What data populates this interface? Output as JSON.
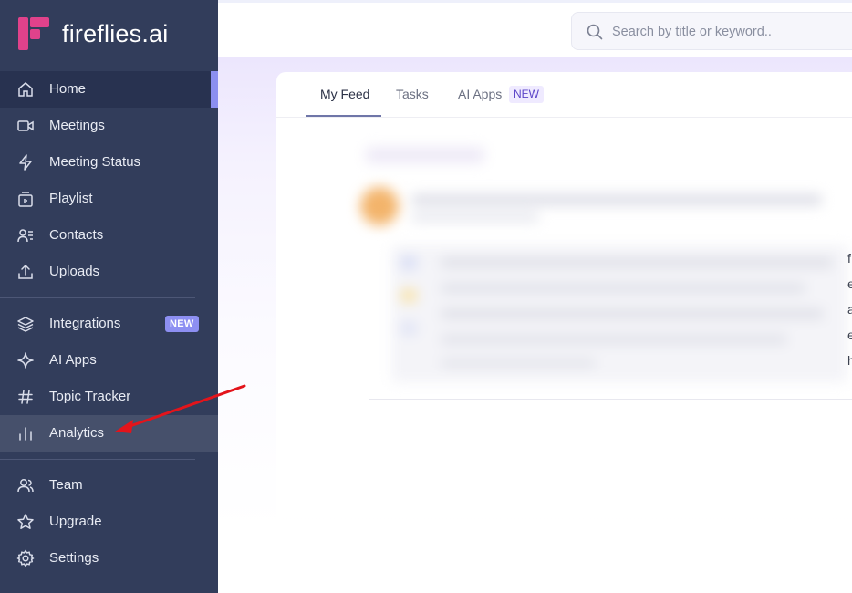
{
  "brand": {
    "name": "fireflies.ai",
    "logo_color": "#e0428b"
  },
  "search": {
    "placeholder": "Search by title or keyword.."
  },
  "sidebar": {
    "items": [
      {
        "label": "Home",
        "icon": "home-icon"
      },
      {
        "label": "Meetings",
        "icon": "video-camera-icon"
      },
      {
        "label": "Meeting Status",
        "icon": "lightning-icon"
      },
      {
        "label": "Playlist",
        "icon": "playlist-icon"
      },
      {
        "label": "Contacts",
        "icon": "contacts-icon"
      },
      {
        "label": "Uploads",
        "icon": "upload-icon"
      },
      {
        "label": "Integrations",
        "icon": "layers-icon",
        "badge": "NEW"
      },
      {
        "label": "AI Apps",
        "icon": "sparkle-icon"
      },
      {
        "label": "Topic Tracker",
        "icon": "hashtag-icon"
      },
      {
        "label": "Analytics",
        "icon": "bar-chart-icon"
      },
      {
        "label": "Team",
        "icon": "team-icon"
      },
      {
        "label": "Upgrade",
        "icon": "star-icon"
      },
      {
        "label": "Settings",
        "icon": "gear-icon"
      }
    ]
  },
  "tabs": {
    "items": [
      {
        "label": "My Feed"
      },
      {
        "label": "Tasks"
      },
      {
        "label": "AI Apps",
        "badge": "NEW"
      }
    ]
  },
  "feed_edge_letters": [
    "f",
    "e",
    "a",
    "e",
    "h"
  ],
  "colors": {
    "sidebar_bg": "#323d5b",
    "active_indicator": "#8b8ff0",
    "annotation_arrow": "#e3141b"
  }
}
